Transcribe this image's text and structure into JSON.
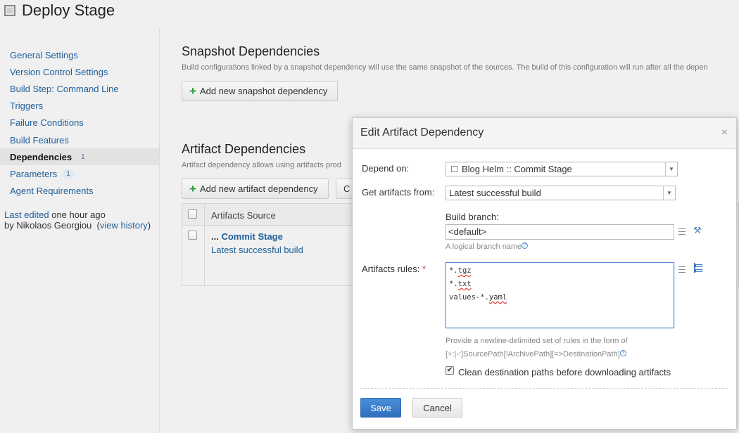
{
  "header": {
    "title": "Deploy Stage",
    "icon": "build-config-icon"
  },
  "sidebar": {
    "items": [
      {
        "label": "General Settings"
      },
      {
        "label": "Version Control Settings"
      },
      {
        "label": "Build Step: Command Line"
      },
      {
        "label": "Triggers"
      },
      {
        "label": "Failure Conditions"
      },
      {
        "label": "Build Features"
      },
      {
        "label": "Dependencies",
        "badge": "1",
        "active": true
      },
      {
        "label": "Parameters",
        "badge": "1"
      },
      {
        "label": "Agent Requirements"
      }
    ],
    "last_edited": {
      "prefix": "Last edited",
      "time": " one hour ago",
      "by": "by Nikolaos Georgiou",
      "history": "view history"
    }
  },
  "snapshot": {
    "title": "Snapshot Dependencies",
    "description": "Build configurations linked by a snapshot dependency will use the same snapshot of the sources. The build of this configuration will run after all the depen",
    "add_button": "Add new snapshot dependency"
  },
  "artifact": {
    "title": "Artifact Dependencies",
    "description": "Artifact dependency allows using artifacts prod",
    "add_button": "Add new artifact dependency",
    "second_button": "C",
    "table": {
      "column_source": "Artifacts Source",
      "rows": [
        {
          "prefix": "... ",
          "source": "Commit Stage",
          "build": "Latest successful build"
        }
      ]
    }
  },
  "dialog": {
    "title": "Edit Artifact Dependency",
    "close": "×",
    "depend_on_label": "Depend on:",
    "depend_on_value": "Blog Helm :: Commit Stage",
    "get_from_label": "Get artifacts from:",
    "get_from_value": "Latest successful build",
    "branch_label": "Build branch:",
    "branch_value": "<default>",
    "branch_hint": "A logical branch name",
    "rules_label": "Artifacts rules:",
    "rules_required": "*",
    "rules_lines": [
      {
        "pre": "*.",
        "word": "tgz"
      },
      {
        "pre": "*.",
        "word": "txt"
      },
      {
        "pre": "values-*.",
        "word": "yaml"
      }
    ],
    "rules_hint_1": "Provide a newline-delimited set of rules in the form of",
    "rules_hint_2": "[+:|-:]SourcePath[!ArchivePath][=>DestinationPath]",
    "clean_label": "Clean destination paths before downloading artifacts",
    "clean_checked": true,
    "save": "Save",
    "cancel": "Cancel"
  }
}
